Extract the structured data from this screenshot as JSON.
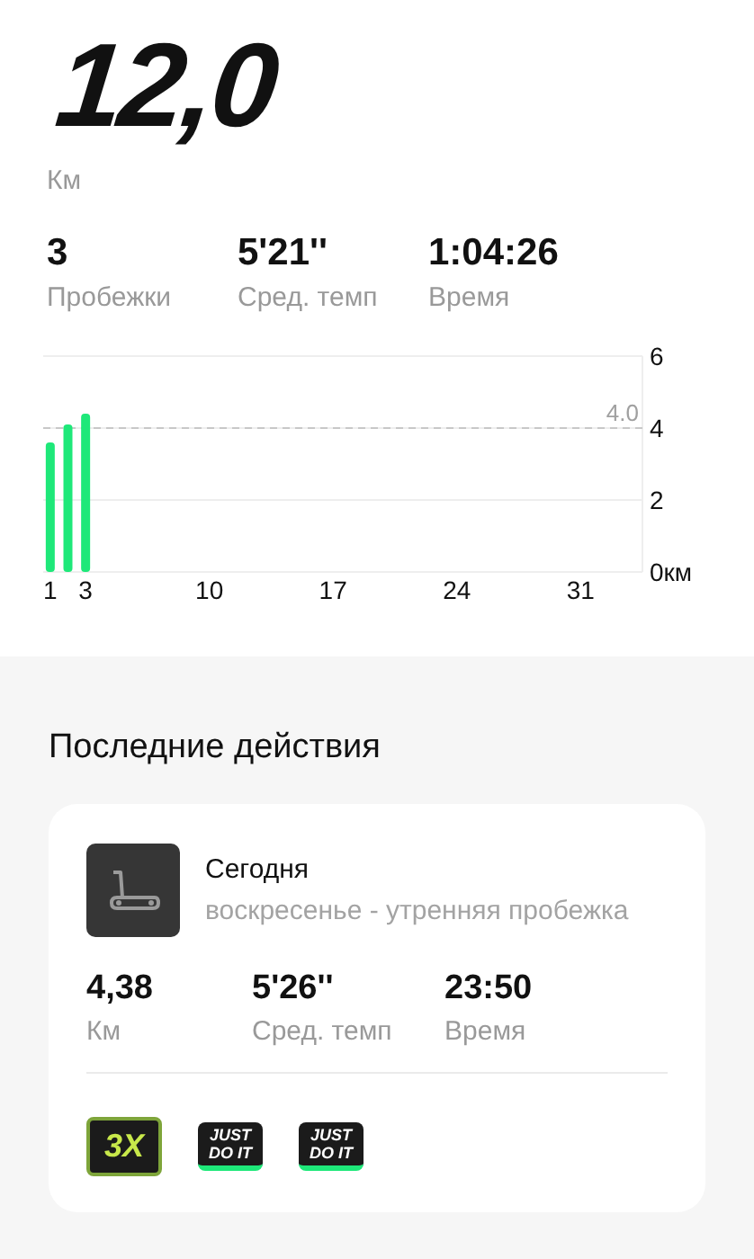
{
  "total": {
    "value": "12,0",
    "unit": "Км"
  },
  "summary": [
    {
      "value": "3",
      "label": "Пробежки"
    },
    {
      "value": "5'21''",
      "label": "Сред. темп"
    },
    {
      "value": "1:04:26",
      "label": "Время"
    }
  ],
  "chart_data": {
    "type": "bar",
    "x": [
      1,
      2,
      3
    ],
    "series": [
      {
        "color": "#1ee879",
        "values": [
          3.6,
          4.1,
          4.4
        ]
      }
    ],
    "xlim": [
      0.6,
      34.5
    ],
    "ylim": [
      0,
      6
    ],
    "xticks": [
      1,
      3,
      10,
      17,
      24,
      31
    ],
    "yticks": [
      {
        "value": 0,
        "label": "0км"
      },
      2,
      4,
      6
    ],
    "ref_lines": [
      {
        "axis": "y",
        "value": 4.0,
        "label": "4.0"
      }
    ]
  },
  "recent": {
    "title": "Последние действия",
    "activity": {
      "day": "Сегодня",
      "description": "воскресенье - утренняя пробежка",
      "stats": [
        {
          "value": "4,38",
          "label": "Км"
        },
        {
          "value": "5'26''",
          "label": "Сред. темп"
        },
        {
          "value": "23:50",
          "label": "Время"
        }
      ],
      "badges": [
        {
          "kind": "multiplier",
          "text": "3X"
        },
        {
          "kind": "slogan",
          "text": "JUST DO IT"
        },
        {
          "kind": "slogan",
          "text": "JUST DO IT"
        }
      ]
    }
  }
}
